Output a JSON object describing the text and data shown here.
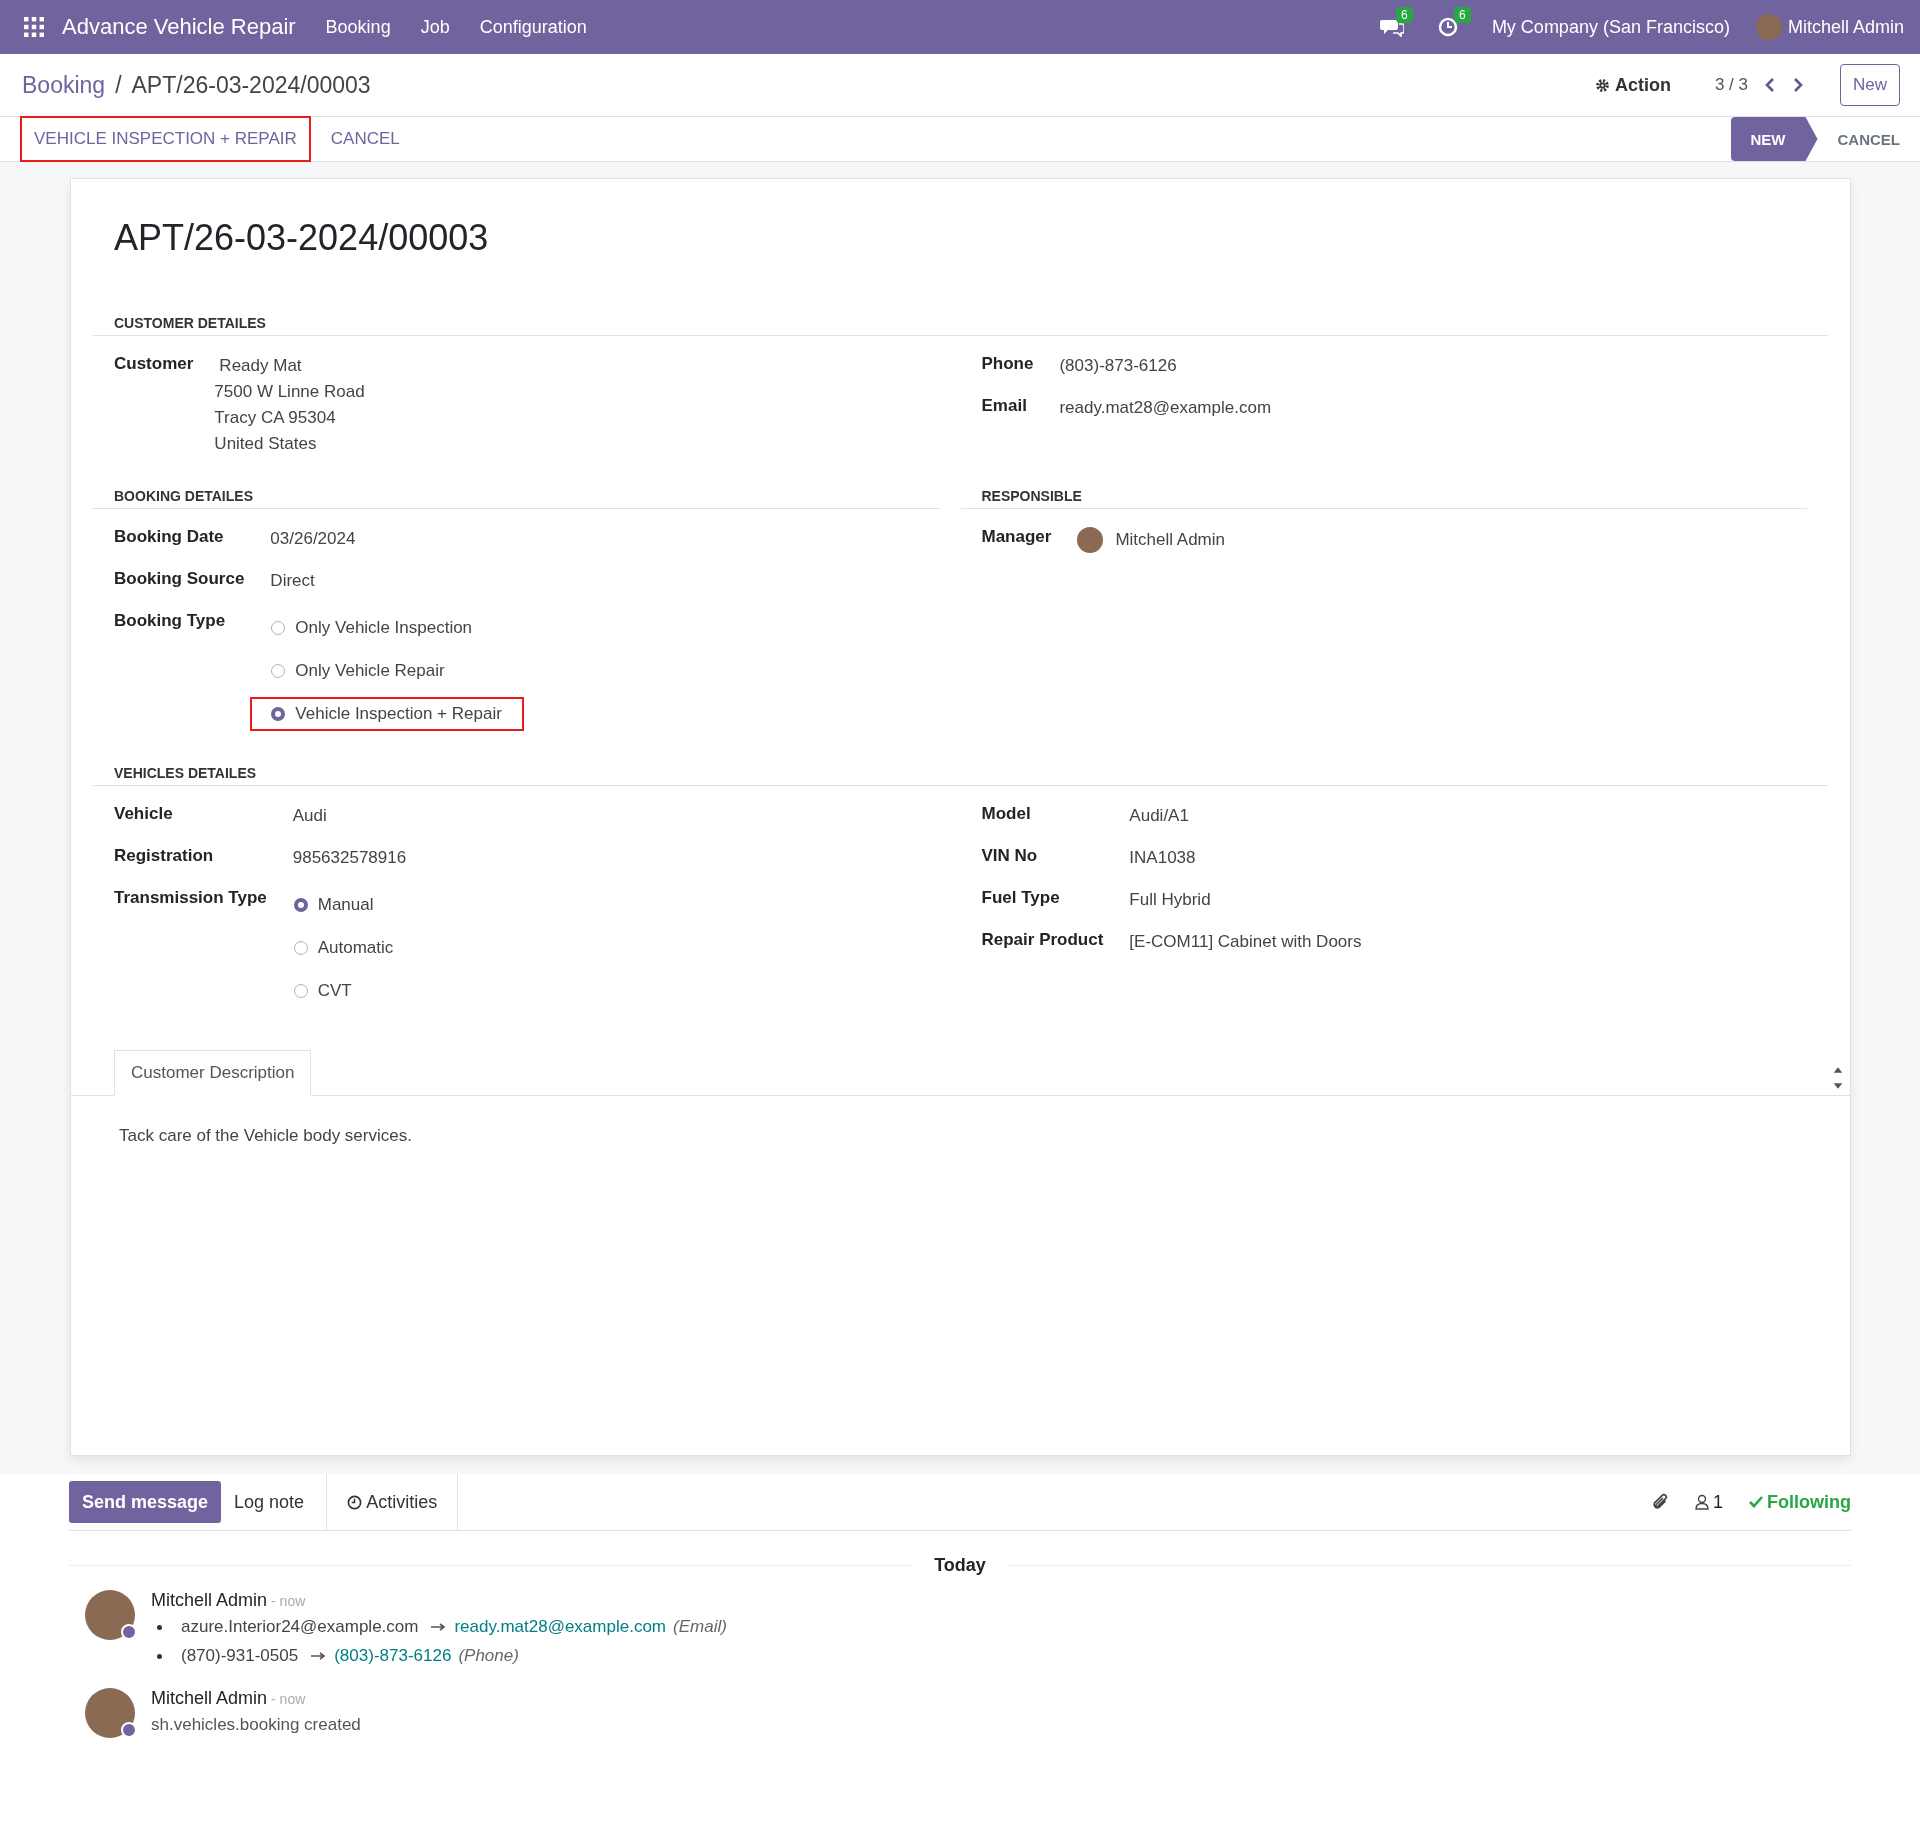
{
  "navbar": {
    "app_name": "Advance Vehicle Repair",
    "menu": [
      "Booking",
      "Job",
      "Configuration"
    ],
    "messages_badge": "6",
    "activities_badge": "6",
    "company": "My Company (San Francisco)",
    "user": "Mitchell Admin"
  },
  "control_panel": {
    "breadcrumb": [
      "Booking",
      "APT/26-03-2024/00003"
    ],
    "separator": "/",
    "action": "Action",
    "pager": "3 / 3",
    "new_button": "New"
  },
  "status_bar": {
    "buttons": [
      {
        "label": "VEHICLE INSPECTION + REPAIR",
        "highlighted": true
      },
      {
        "label": "CANCEL",
        "highlighted": false
      }
    ],
    "stages": [
      {
        "label": "NEW",
        "selected": true
      },
      {
        "label": "CANCEL",
        "selected": false
      }
    ]
  },
  "form": {
    "title": "APT/26-03-2024/00003",
    "sections": [
      {
        "heading": "CUSTOMER DETAILES",
        "columns": [
          {
            "fields": [
              {
                "kind": "text",
                "label": "Customer",
                "lines": [
                  "Ready Mat",
                  "7500 W Linne Road",
                  "Tracy CA 95304",
                  "United States"
                ]
              }
            ]
          },
          {
            "fields": [
              {
                "kind": "text",
                "label": "Phone",
                "lines": [
                  "(803)-873-6126"
                ]
              },
              {
                "kind": "text",
                "label": "Email",
                "lines": [
                  "ready.mat28@example.com"
                ]
              }
            ]
          }
        ]
      },
      {
        "columns": [
          {
            "heading": "BOOKING DETAILES",
            "fields": [
              {
                "kind": "text",
                "label": "Booking Date",
                "lines": [
                  "03/26/2024"
                ]
              },
              {
                "kind": "text",
                "label": "Booking Source",
                "lines": [
                  "Direct"
                ]
              },
              {
                "kind": "radio",
                "label": "Booking Type",
                "options": [
                  {
                    "label": "Only Vehicle Inspection",
                    "selected": false,
                    "highlighted": false
                  },
                  {
                    "label": "Only Vehicle Repair",
                    "selected": false,
                    "highlighted": false
                  },
                  {
                    "label": "Vehicle Inspection + Repair",
                    "selected": true,
                    "highlighted": true
                  }
                ]
              }
            ]
          },
          {
            "heading": "RESPONSIBLE",
            "fields": [
              {
                "kind": "user",
                "label": "Manager",
                "lines": [
                  "Mitchell Admin"
                ]
              }
            ]
          }
        ]
      },
      {
        "heading": "VEHICLES DETAILES",
        "columns": [
          {
            "fields": [
              {
                "kind": "text",
                "label": "Vehicle",
                "lines": [
                  "Audi"
                ]
              },
              {
                "kind": "text",
                "label": "Registration",
                "lines": [
                  "985632578916"
                ]
              },
              {
                "kind": "radio",
                "label": "Transmission Type",
                "options": [
                  {
                    "label": "Manual",
                    "selected": true,
                    "highlighted": false
                  },
                  {
                    "label": "Automatic",
                    "selected": false,
                    "highlighted": false
                  },
                  {
                    "label": "CVT",
                    "selected": false,
                    "highlighted": false
                  }
                ]
              }
            ]
          },
          {
            "fields": [
              {
                "kind": "text",
                "label": "Model",
                "lines": [
                  "Audi/A1"
                ]
              },
              {
                "kind": "text",
                "label": "VIN No",
                "lines": [
                  "INA1038"
                ]
              },
              {
                "kind": "text",
                "label": "Fuel Type",
                "lines": [
                  "Full Hybrid"
                ]
              },
              {
                "kind": "text",
                "label": "Repair Product",
                "lines": [
                  "[E-COM11] Cabinet with Doors"
                ]
              }
            ]
          }
        ]
      }
    ],
    "notebook": {
      "tabs": [
        {
          "label": "Customer Description",
          "selected": true
        }
      ],
      "content": "Tack care of the Vehicle body services."
    }
  },
  "chatter": {
    "buttons": [
      {
        "label": "Send message",
        "selected": true
      },
      {
        "label": "Log note",
        "selected": false
      },
      {
        "label": "Activities",
        "selected": false
      }
    ],
    "followers": "1",
    "following": "Following",
    "divider": "Today",
    "messages": [
      {
        "author": "Mitchell Admin",
        "time": "- now",
        "changes": [
          {
            "old": "azure.Interior24@example.com",
            "new": "ready.mat28@example.com",
            "field": "(Email)"
          },
          {
            "old": "(870)-931-0505",
            "new": "(803)-873-6126",
            "field": "(Phone)"
          }
        ]
      },
      {
        "author": "Mitchell Admin",
        "time": "- now",
        "body": "sh.vehicles.booking created"
      }
    ]
  }
}
